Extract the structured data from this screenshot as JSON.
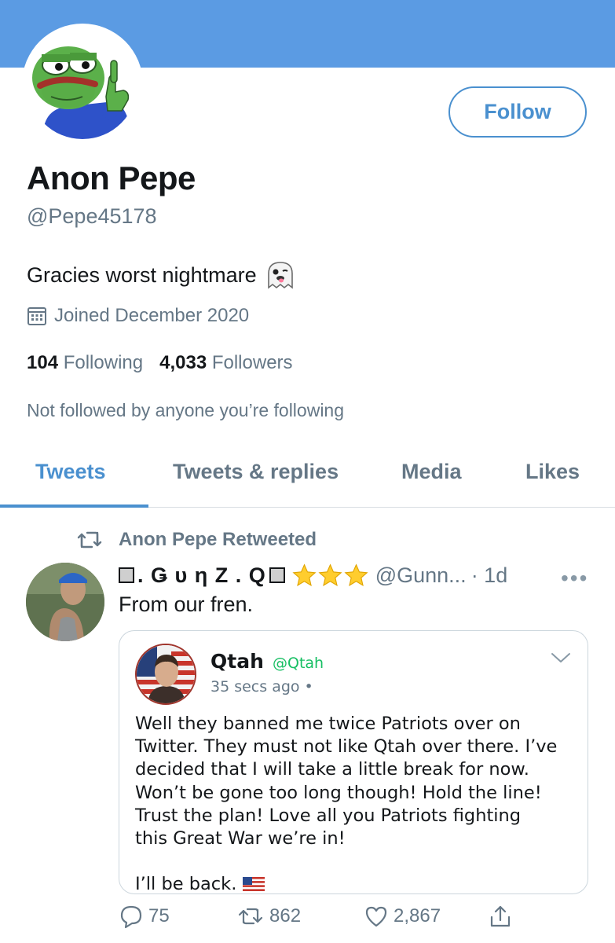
{
  "colors": {
    "banner": "#5b9be3",
    "accent": "#4a90cf",
    "text_muted": "#657786",
    "border": "#ccd6dd"
  },
  "profile": {
    "display_name": "Anon Pepe",
    "handle": "@Pepe45178",
    "bio": "Gracies worst nightmare",
    "bio_emoji": "ghost-emoji",
    "joined": "Joined December 2020",
    "following_count": "104",
    "following_label": "Following",
    "followers_count": "4,033",
    "followers_label": "Followers",
    "not_followed": "Not followed by anyone you’re following",
    "follow_button": "Follow"
  },
  "tabs": [
    {
      "label": "Tweets",
      "active": true
    },
    {
      "label": "Tweets & replies",
      "active": false
    },
    {
      "label": "Media",
      "active": false
    },
    {
      "label": "Likes",
      "active": false
    }
  ],
  "tweet": {
    "retweeted_by": "Anon Pepe Retweeted",
    "author_name": ". Ǥ υ η Z . Q",
    "author_handle": "@Gunn...",
    "time": "· 1d",
    "more": "•••",
    "text": "From our fren.",
    "embed": {
      "name": "Qtah",
      "handle": "@Qtah",
      "time": "35 secs ago •",
      "body": "Well they banned me twice Patriots over on\nTwitter. They must not like Qtah over there. I’ve\ndecided that I will take a little break for now.\nWon’t be gone too long though! Hold the line!\nTrust the plan! Love all you Patriots fighting\nthis Great War we’re in!\n\nI’ll be back."
    },
    "replies": "75",
    "retweets": "862",
    "likes": "2,867"
  }
}
